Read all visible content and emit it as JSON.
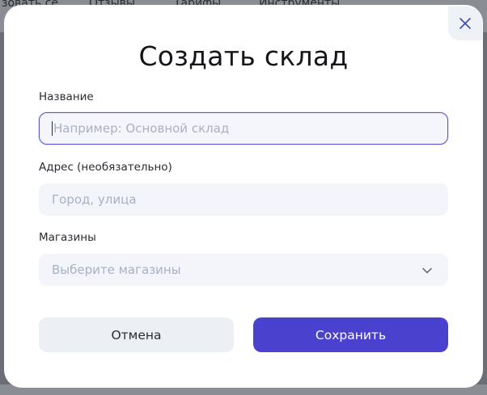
{
  "backdrop": {
    "nav_items": [
      "зовать се",
      "Отзывы",
      "Тарифы",
      "Инструменты"
    ]
  },
  "dialog": {
    "title": "Создать склад",
    "close_icon": "close-icon",
    "fields": {
      "name": {
        "label": "Название",
        "placeholder": "Например: Основной склад",
        "value": ""
      },
      "address": {
        "label": "Адрес (необязательно)",
        "placeholder": "Город, улица",
        "value": ""
      },
      "stores": {
        "label": "Магазины",
        "placeholder": "Выберите магазины",
        "icon": "chevron-down-icon"
      }
    },
    "buttons": {
      "cancel": "Отмена",
      "save": "Сохранить"
    }
  },
  "colors": {
    "accent": "#4a42cf",
    "field_bg": "#f3f5fb",
    "cancel_bg": "#eceff4",
    "focus_border": "#5a53d6"
  }
}
